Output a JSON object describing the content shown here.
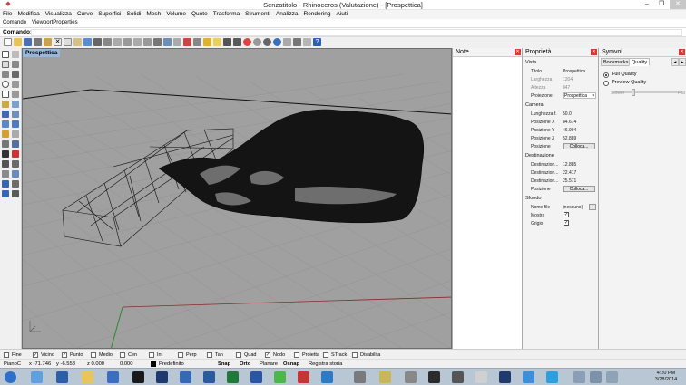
{
  "window": {
    "title": "Senzatitolo - Rhinoceros (Valutazione) - [Prospettica]",
    "minimize": "–",
    "maximize": "❐",
    "close": "✕"
  },
  "menu": [
    "File",
    "Modifica",
    "Visualizza",
    "Curve",
    "Superfici",
    "Solidi",
    "Mesh",
    "Volume",
    "Quote",
    "Trasforma",
    "Strumenti",
    "Analizza",
    "Rendering",
    "Aiuti"
  ],
  "subtabs": [
    "Comando",
    "ViewportProperties"
  ],
  "command": {
    "label": "Comando:",
    "value": ""
  },
  "viewport": {
    "label": "Prospettica"
  },
  "note_panel": {
    "title": "Note"
  },
  "properties": {
    "title": "Proprietà",
    "sections": {
      "vista": "Vista",
      "camera": "Camera",
      "destinazione": "Destinazione",
      "sfondo": "Sfondo"
    },
    "vista_rows": [
      {
        "key": "Titolo",
        "value": "Prospettica",
        "disabled": false
      },
      {
        "key": "Larghezza",
        "value": "1204",
        "disabled": true
      },
      {
        "key": "Altezza",
        "value": "847",
        "disabled": true
      },
      {
        "key": "Proiezione",
        "value": "Prospettica",
        "disabled": false
      }
    ],
    "camera_rows": [
      {
        "key": "Lunghezza f.",
        "value": "50.0"
      },
      {
        "key": "Posizione X",
        "value": "84.674"
      },
      {
        "key": "Posizione Y",
        "value": "46.994"
      },
      {
        "key": "Posizione Z",
        "value": "52.889"
      },
      {
        "key": "Posizione",
        "button": "Colloca..."
      }
    ],
    "dest_rows": [
      {
        "key": "Destinazion...",
        "value": "12.885"
      },
      {
        "key": "Destinazion...",
        "value": "22.417"
      },
      {
        "key": "Destinazion...",
        "value": "25.571"
      },
      {
        "key": "Posizione",
        "button": "Colloca..."
      }
    ],
    "sfondo_rows": [
      {
        "key": "Nome file",
        "value": "(nessuno)",
        "small_button": "..."
      },
      {
        "key": "Mostra",
        "checked": true
      },
      {
        "key": "Grigio",
        "checked": true
      }
    ]
  },
  "symvol": {
    "title": "Symvol",
    "tabs": [
      "Bookmarks",
      "Quality"
    ],
    "active_tab": "Quality",
    "options": [
      {
        "label": "Full Quality",
        "selected": true
      },
      {
        "label": "Preview Quality",
        "selected": false
      }
    ],
    "slider_left": "Slower",
    "slider_right": "Fas"
  },
  "osnap": [
    {
      "label": "Fine",
      "checked": false
    },
    {
      "label": "Vicino",
      "checked": true
    },
    {
      "label": "Punto",
      "checked": true
    },
    {
      "label": "Medio",
      "checked": false
    },
    {
      "label": "Cen",
      "checked": false
    },
    {
      "label": "Int",
      "checked": false
    },
    {
      "label": "Perp",
      "checked": false
    },
    {
      "label": "Tan",
      "checked": false
    },
    {
      "label": "Quad",
      "checked": false
    },
    {
      "label": "Nodo",
      "checked": true
    },
    {
      "label": "Proietta",
      "checked": false
    },
    {
      "label": "STrack",
      "checked": false
    },
    {
      "label": "Disabilita",
      "checked": false
    }
  ],
  "status": {
    "cplane": "PianoC",
    "x": "x -71.746",
    "y": "y -6.558",
    "z": "z 0.000",
    "w": "0.000",
    "layer": "Predefinito",
    "snap": "Snap",
    "orto": "Orto",
    "planare": "Planare",
    "osnap": "Osnap",
    "history": "Registra storia"
  },
  "clock": {
    "time": "4:20 PM",
    "date": "3/28/2014"
  },
  "colors": {
    "viewport_bg": "#a0a0a0",
    "viewport_label": "#98b7d9",
    "close_red": "#d93a2f",
    "taskbar": "#b9c6d3"
  }
}
